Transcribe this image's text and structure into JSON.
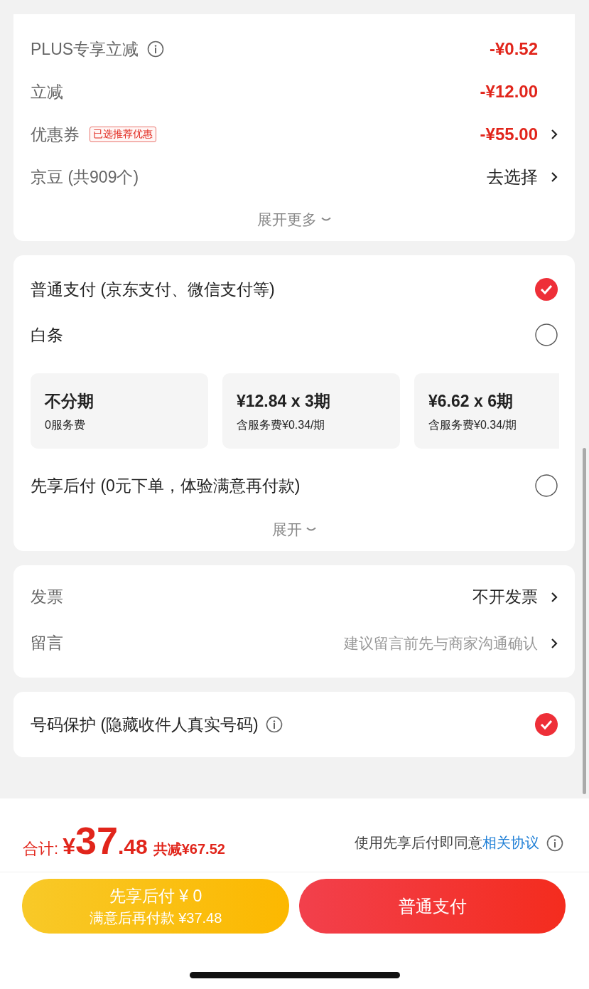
{
  "discounts": {
    "rows": [
      {
        "kind": "discount",
        "label": "PLUS专享立减",
        "info": true,
        "value": "-¥0.52",
        "chevron": false
      },
      {
        "kind": "discount",
        "label": "立减",
        "info": false,
        "value": "-¥12.00",
        "chevron": false
      },
      {
        "kind": "discount",
        "label": "优惠券",
        "info": false,
        "tag": "已选推荐优惠",
        "value": "-¥55.00",
        "chevron": true
      },
      {
        "kind": "action",
        "label": "京豆 (共909个)",
        "info": false,
        "value": "去选择",
        "chevron": true
      }
    ],
    "expand": "展开更多"
  },
  "payment": {
    "items": [
      {
        "kind": "option",
        "label": "普通支付 (京东支付、微信支付等)",
        "selected": true
      },
      {
        "kind": "option",
        "label": "白条",
        "selected": false
      },
      {
        "kind": "plans",
        "plans": [
          {
            "title": "不分期",
            "fee": "0服务费"
          },
          {
            "title": "¥12.84 x 3期",
            "fee": "含服务费¥0.34/期"
          },
          {
            "title": "¥6.62 x 6期",
            "fee": "含服务费¥0.34/期"
          }
        ]
      },
      {
        "kind": "option",
        "label": "先享后付 (0元下单，体验满意再付款)",
        "selected": false
      }
    ],
    "expand": "展开"
  },
  "extras": {
    "rows": [
      {
        "kind": "value",
        "label": "发票",
        "value": "不开发票"
      },
      {
        "kind": "hint",
        "label": "留言",
        "value": "建议留言前先与商家沟通确认"
      }
    ]
  },
  "protection": {
    "label": "号码保护 (隐藏收件人真实号码)",
    "info": true,
    "checked": true
  },
  "footer": {
    "total_label": "合计:",
    "currency": "¥",
    "integer": "37",
    "decimal": ".48",
    "saved": "共减¥67.52",
    "agreement": "使用先享后付即同意",
    "agreement_link": "相关协议",
    "bnpl_button": {
      "line1": "先享后付 ¥ 0",
      "line2": "满意后再付款 ¥37.48"
    },
    "pay_button": "普通支付"
  }
}
